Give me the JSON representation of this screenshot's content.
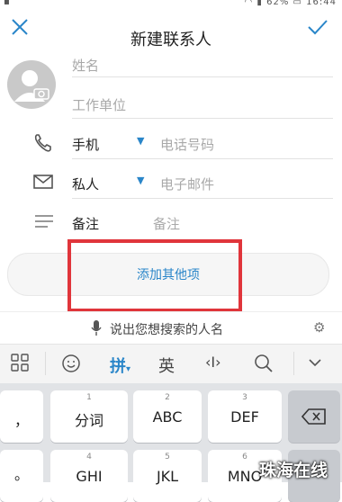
{
  "status_bar": {
    "battery": "62%",
    "time": "16:44"
  },
  "header": {
    "title": "新建联系人"
  },
  "form": {
    "name_placeholder": "姓名",
    "company_placeholder": "工作单位",
    "phone": {
      "type_label": "手机",
      "placeholder": "电话号码"
    },
    "email": {
      "type_label": "私人",
      "placeholder": "电子邮件"
    },
    "note": {
      "label": "备注",
      "placeholder": "备注"
    }
  },
  "add_other_label": "添加其他项",
  "voice_search": {
    "prompt": "说出您想搜索的人名"
  },
  "ime_toolbar": {
    "pinyin": "拼",
    "english": "英"
  },
  "keyboard": {
    "rows": [
      [
        {
          "num": "",
          "label": "，"
        },
        {
          "num": "1",
          "label": "分词"
        },
        {
          "num": "2",
          "label": "ABC"
        },
        {
          "num": "3",
          "label": "DEF"
        }
      ],
      [
        {
          "num": "",
          "label": "。"
        },
        {
          "num": "4",
          "label": "GHI"
        },
        {
          "num": "5",
          "label": "JKL"
        },
        {
          "num": "6",
          "label": "MNO"
        }
      ]
    ]
  },
  "watermark": "珠海在线",
  "colors": {
    "accent": "#2a86c9",
    "highlight_box": "#e0353b"
  }
}
